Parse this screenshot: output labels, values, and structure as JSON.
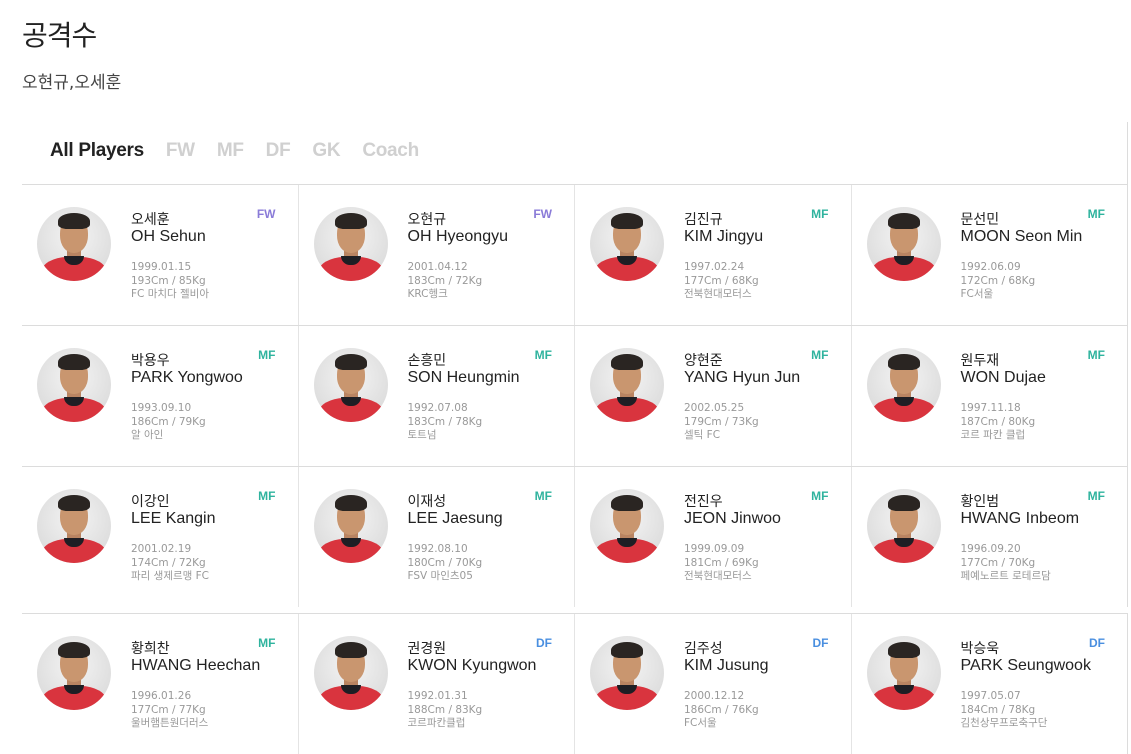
{
  "page": {
    "title": "공격수",
    "subtitle": "오현규,오세훈"
  },
  "filters": [
    {
      "label": "All Players",
      "active": true
    },
    {
      "label": "FW",
      "active": false
    },
    {
      "label": "MF",
      "active": false
    },
    {
      "label": "DF",
      "active": false
    },
    {
      "label": "GK",
      "active": false
    },
    {
      "label": "Coach",
      "active": false
    }
  ],
  "players": [
    {
      "korean": "오세훈",
      "english": "OH Sehun",
      "position": "FW",
      "birth": "1999.01.15",
      "body": "193Cm / 85Kg",
      "club": "FC 마치다 젤비아"
    },
    {
      "korean": "오현규",
      "english": "OH Hyeongyu",
      "position": "FW",
      "birth": "2001.04.12",
      "body": "183Cm / 72Kg",
      "club": "KRC헹크"
    },
    {
      "korean": "김진규",
      "english": "KIM Jingyu",
      "position": "MF",
      "birth": "1997.02.24",
      "body": "177Cm / 68Kg",
      "club": "전북현대모터스"
    },
    {
      "korean": "문선민",
      "english": "MOON Seon Min",
      "position": "MF",
      "birth": "1992.06.09",
      "body": "172Cm / 68Kg",
      "club": "FC서울"
    },
    {
      "korean": "박용우",
      "english": "PARK Yongwoo",
      "position": "MF",
      "birth": "1993.09.10",
      "body": "186Cm / 79Kg",
      "club": "알 아인"
    },
    {
      "korean": "손흥민",
      "english": "SON Heungmin",
      "position": "MF",
      "birth": "1992.07.08",
      "body": "183Cm / 78Kg",
      "club": "토트넘"
    },
    {
      "korean": "양현준",
      "english": "YANG Hyun Jun",
      "position": "MF",
      "birth": "2002.05.25",
      "body": "179Cm / 73Kg",
      "club": "셀틱 FC"
    },
    {
      "korean": "원두재",
      "english": "WON Dujae",
      "position": "MF",
      "birth": "1997.11.18",
      "body": "187Cm / 80Kg",
      "club": "코르 파칸 클럽"
    },
    {
      "korean": "이강인",
      "english": "LEE Kangin",
      "position": "MF",
      "birth": "2001.02.19",
      "body": "174Cm / 72Kg",
      "club": "파리 생제르맹 FC"
    },
    {
      "korean": "이재성",
      "english": "LEE Jaesung",
      "position": "MF",
      "birth": "1992.08.10",
      "body": "180Cm / 70Kg",
      "club": "FSV 마인츠05"
    },
    {
      "korean": "전진우",
      "english": "JEON Jinwoo",
      "position": "MF",
      "birth": "1999.09.09",
      "body": "181Cm / 69Kg",
      "club": "전북현대모터스"
    },
    {
      "korean": "황인범",
      "english": "HWANG Inbeom",
      "position": "MF",
      "birth": "1996.09.20",
      "body": "177Cm / 70Kg",
      "club": "페예노르트 로테르담"
    },
    {
      "korean": "황희찬",
      "english": "HWANG Heechan",
      "position": "MF",
      "birth": "1996.01.26",
      "body": "177Cm / 77Kg",
      "club": "울버햄튼원더러스"
    },
    {
      "korean": "권경원",
      "english": "KWON Kyungwon",
      "position": "DF",
      "birth": "1992.01.31",
      "body": "188Cm / 83Kg",
      "club": "코르파칸클럽"
    },
    {
      "korean": "김주성",
      "english": "KIM Jusung",
      "position": "DF",
      "birth": "2000.12.12",
      "body": "186Cm / 76Kg",
      "club": "FC서울"
    },
    {
      "korean": "박승욱",
      "english": "PARK Seungwook",
      "position": "DF",
      "birth": "1997.05.07",
      "body": "184Cm / 78Kg",
      "club": "김천상무프로축구단"
    }
  ]
}
